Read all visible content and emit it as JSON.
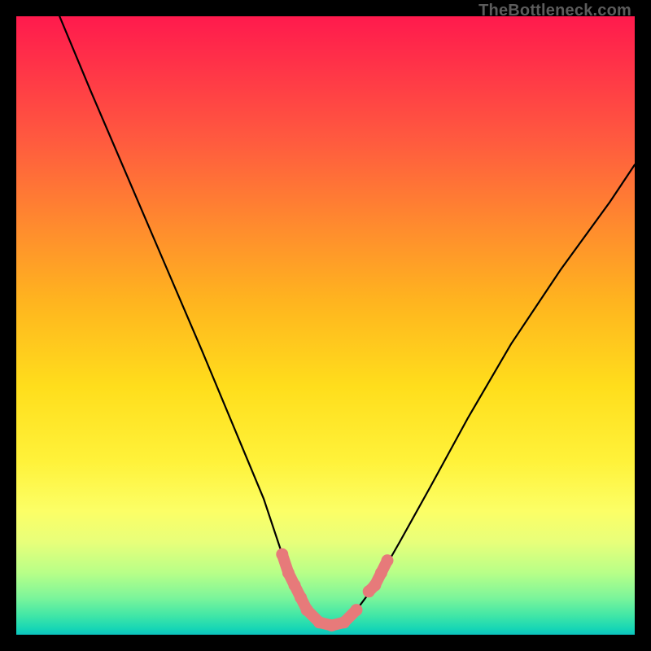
{
  "watermark": "TheBottleneck.com",
  "chart_data": {
    "type": "line",
    "title": "",
    "xlabel": "",
    "ylabel": "",
    "xlim": [
      0,
      100
    ],
    "ylim": [
      0,
      100
    ],
    "series": [
      {
        "name": "bottleneck-curve",
        "x": [
          7,
          12,
          18,
          24,
          30,
          35,
          40,
          43,
          45,
          47,
          49,
          51,
          53,
          55,
          58,
          62,
          67,
          73,
          80,
          88,
          96,
          100
        ],
        "values": [
          100,
          88,
          74,
          60,
          46,
          34,
          22,
          13,
          8,
          4,
          2,
          1.5,
          2,
          4,
          8,
          15,
          24,
          35,
          47,
          59,
          70,
          76
        ]
      }
    ],
    "markers": {
      "name": "highlight-segments",
      "color": "#e77a7a",
      "segments": [
        {
          "x": [
            43,
            44,
            45,
            46,
            47
          ],
          "values": [
            13,
            10,
            8,
            6,
            4
          ]
        },
        {
          "x": [
            47,
            49,
            51,
            53,
            55
          ],
          "values": [
            4,
            2,
            1.5,
            2,
            4
          ]
        },
        {
          "x": [
            57,
            58,
            59,
            60
          ],
          "values": [
            7,
            8,
            10,
            12
          ]
        }
      ]
    }
  }
}
